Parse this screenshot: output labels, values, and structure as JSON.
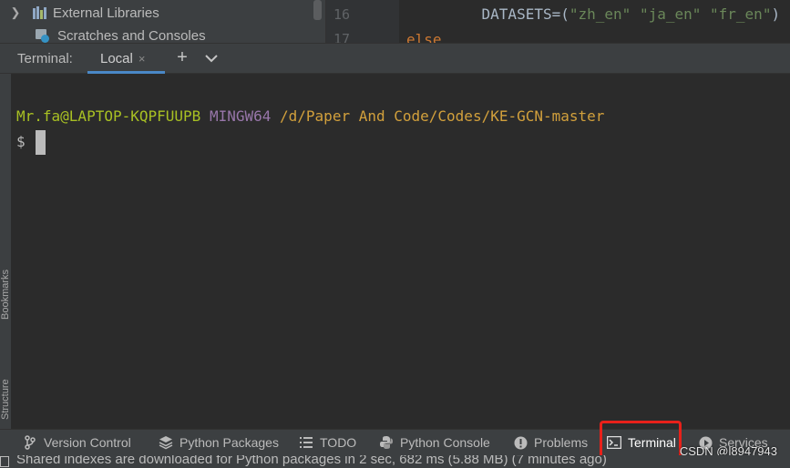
{
  "project_tree": {
    "items": [
      {
        "label": "External Libraries",
        "icon": "library-icon",
        "expandable": true
      },
      {
        "label": "Scratches and Consoles",
        "icon": "scratches-icon",
        "expandable": false
      }
    ]
  },
  "editor": {
    "lines": [
      {
        "number": "16",
        "code_prefix": "    DATASETS=(",
        "strings": [
          "\"zh_en\"",
          "\"ja_en\"",
          "\"fr_en\""
        ],
        "code_suffix": ")"
      },
      {
        "number": "17",
        "code": "else"
      }
    ]
  },
  "terminal": {
    "title": "Terminal:",
    "tabs": [
      {
        "label": "Local",
        "close_glyph": "×"
      }
    ],
    "new_tab_glyph": "+",
    "prompt": {
      "user_host": "Mr.fa@LAPTOP-KQPFUUPB",
      "env": "MINGW64",
      "path": "/d/Paper And Code/Codes/KE-GCN-master"
    },
    "input_line": "$ "
  },
  "side_stripe": {
    "labels": [
      "Bookmarks",
      "Structure"
    ]
  },
  "tool_windows": [
    {
      "label": "Version Control",
      "icon": "branch-icon"
    },
    {
      "label": "Python Packages",
      "icon": "packages-icon"
    },
    {
      "label": "TODO",
      "icon": "todo-list-icon"
    },
    {
      "label": "Python Console",
      "icon": "python-icon"
    },
    {
      "label": "Problems",
      "icon": "warning-icon"
    },
    {
      "label": "Terminal",
      "icon": "terminal-icon",
      "active": true
    },
    {
      "label": "Services",
      "icon": "play-icon"
    }
  ],
  "status_bar": {
    "message": "Shared indexes are downloaded for Python packages in 2 sec, 682 ms (5.88 MB) (7 minutes ago)"
  },
  "watermark": "CSDN @l8947943",
  "colors": {
    "background": "#2b2b2b",
    "panel": "#3c3f41",
    "prompt_user": "#a8c023",
    "prompt_env": "#9876aa",
    "prompt_path": "#d2a03c",
    "highlight": "#e8211a",
    "tab_underline": "#4a88c7"
  }
}
